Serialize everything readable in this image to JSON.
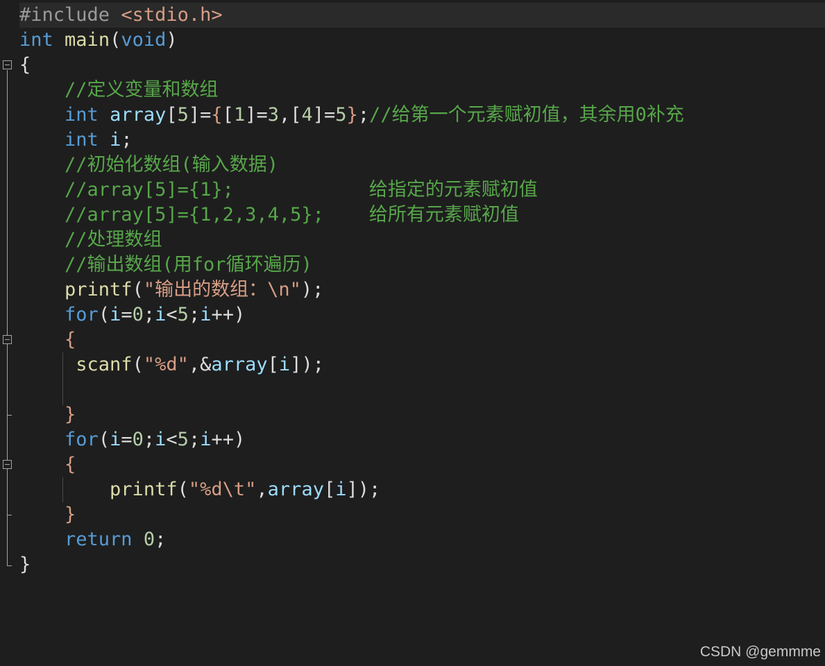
{
  "colors": {
    "background": "#1e1e1e",
    "current_line": "#2a2a2a",
    "text": "#dcdcdc",
    "preprocessor": "#9b9b9b",
    "include_path": "#d69d85",
    "keyword": "#569cd6",
    "function": "#dcdcaa",
    "variable": "#9cdcfe",
    "number": "#b5cea8",
    "string": "#d69d85",
    "comment": "#57a64a",
    "brace": "#d69d85"
  },
  "code_lines": [
    {
      "tokens": [
        {
          "t": "#include",
          "c": "preprocessor"
        },
        {
          "t": " ",
          "c": "text"
        },
        {
          "t": "<stdio.h>",
          "c": "include_path"
        }
      ]
    },
    {
      "tokens": [
        {
          "t": "int",
          "c": "keyword"
        },
        {
          "t": " ",
          "c": "text"
        },
        {
          "t": "main",
          "c": "function"
        },
        {
          "t": "(",
          "c": "text"
        },
        {
          "t": "void",
          "c": "keyword"
        },
        {
          "t": ")",
          "c": "text"
        }
      ]
    },
    {
      "tokens": [
        {
          "t": "{",
          "c": "text"
        }
      ]
    },
    {
      "tokens": [
        {
          "t": "    ",
          "c": "text"
        },
        {
          "t": "//定义变量和数组",
          "c": "comment"
        }
      ]
    },
    {
      "tokens": [
        {
          "t": "    ",
          "c": "text"
        },
        {
          "t": "int",
          "c": "keyword"
        },
        {
          "t": " ",
          "c": "text"
        },
        {
          "t": "array",
          "c": "variable"
        },
        {
          "t": "[",
          "c": "text"
        },
        {
          "t": "5",
          "c": "number"
        },
        {
          "t": "]=",
          "c": "text"
        },
        {
          "t": "{",
          "c": "brace"
        },
        {
          "t": "[",
          "c": "text"
        },
        {
          "t": "1",
          "c": "number"
        },
        {
          "t": "]=",
          "c": "text"
        },
        {
          "t": "3",
          "c": "number"
        },
        {
          "t": ",[",
          "c": "text"
        },
        {
          "t": "4",
          "c": "number"
        },
        {
          "t": "]=",
          "c": "text"
        },
        {
          "t": "5",
          "c": "number"
        },
        {
          "t": "}",
          "c": "brace"
        },
        {
          "t": ";",
          "c": "text"
        },
        {
          "t": "//给第一个元素赋初值，其余用0补充",
          "c": "comment"
        }
      ]
    },
    {
      "tokens": [
        {
          "t": "    ",
          "c": "text"
        },
        {
          "t": "int",
          "c": "keyword"
        },
        {
          "t": " ",
          "c": "text"
        },
        {
          "t": "i",
          "c": "variable"
        },
        {
          "t": ";",
          "c": "text"
        }
      ]
    },
    {
      "tokens": [
        {
          "t": "    ",
          "c": "text"
        },
        {
          "t": "//初始化数组(输入数据)",
          "c": "comment"
        }
      ]
    },
    {
      "tokens": [
        {
          "t": "    ",
          "c": "text"
        },
        {
          "t": "//array[5]={1};            给指定的元素赋初值",
          "c": "comment"
        }
      ]
    },
    {
      "tokens": [
        {
          "t": "    ",
          "c": "text"
        },
        {
          "t": "//array[5]={1,2,3,4,5};    给所有元素赋初值",
          "c": "comment"
        }
      ]
    },
    {
      "tokens": [
        {
          "t": "    ",
          "c": "text"
        },
        {
          "t": "//处理数组",
          "c": "comment"
        }
      ]
    },
    {
      "tokens": [
        {
          "t": "    ",
          "c": "text"
        },
        {
          "t": "//输出数组(用for循环遍历)",
          "c": "comment"
        }
      ]
    },
    {
      "tokens": [
        {
          "t": "    ",
          "c": "text"
        },
        {
          "t": "printf",
          "c": "function"
        },
        {
          "t": "(",
          "c": "text"
        },
        {
          "t": "\"输出的数组：\\n\"",
          "c": "string"
        },
        {
          "t": ");",
          "c": "text"
        }
      ]
    },
    {
      "tokens": [
        {
          "t": "    ",
          "c": "text"
        },
        {
          "t": "for",
          "c": "keyword"
        },
        {
          "t": "(",
          "c": "text"
        },
        {
          "t": "i",
          "c": "variable"
        },
        {
          "t": "=",
          "c": "text"
        },
        {
          "t": "0",
          "c": "number"
        },
        {
          "t": ";",
          "c": "text"
        },
        {
          "t": "i",
          "c": "variable"
        },
        {
          "t": "<",
          "c": "text"
        },
        {
          "t": "5",
          "c": "number"
        },
        {
          "t": ";",
          "c": "text"
        },
        {
          "t": "i",
          "c": "variable"
        },
        {
          "t": "++)",
          "c": "text"
        }
      ]
    },
    {
      "tokens": [
        {
          "t": "    ",
          "c": "text"
        },
        {
          "t": "{",
          "c": "brace"
        }
      ]
    },
    {
      "tokens": [
        {
          "t": "     ",
          "c": "text"
        },
        {
          "t": "scanf",
          "c": "function"
        },
        {
          "t": "(",
          "c": "text"
        },
        {
          "t": "\"%d\"",
          "c": "string"
        },
        {
          "t": ",&",
          "c": "text"
        },
        {
          "t": "array",
          "c": "variable"
        },
        {
          "t": "[",
          "c": "text"
        },
        {
          "t": "i",
          "c": "variable"
        },
        {
          "t": "]);",
          "c": "text"
        }
      ]
    },
    {
      "tokens": []
    },
    {
      "tokens": [
        {
          "t": "    ",
          "c": "text"
        },
        {
          "t": "}",
          "c": "brace"
        }
      ]
    },
    {
      "tokens": [
        {
          "t": "    ",
          "c": "text"
        },
        {
          "t": "for",
          "c": "keyword"
        },
        {
          "t": "(",
          "c": "text"
        },
        {
          "t": "i",
          "c": "variable"
        },
        {
          "t": "=",
          "c": "text"
        },
        {
          "t": "0",
          "c": "number"
        },
        {
          "t": ";",
          "c": "text"
        },
        {
          "t": "i",
          "c": "variable"
        },
        {
          "t": "<",
          "c": "text"
        },
        {
          "t": "5",
          "c": "number"
        },
        {
          "t": ";",
          "c": "text"
        },
        {
          "t": "i",
          "c": "variable"
        },
        {
          "t": "++)",
          "c": "text"
        }
      ]
    },
    {
      "tokens": [
        {
          "t": "    ",
          "c": "text"
        },
        {
          "t": "{",
          "c": "brace"
        }
      ]
    },
    {
      "tokens": [
        {
          "t": "        ",
          "c": "text"
        },
        {
          "t": "printf",
          "c": "function"
        },
        {
          "t": "(",
          "c": "text"
        },
        {
          "t": "\"%d\\t\"",
          "c": "string"
        },
        {
          "t": ",",
          "c": "text"
        },
        {
          "t": "array",
          "c": "variable"
        },
        {
          "t": "[",
          "c": "text"
        },
        {
          "t": "i",
          "c": "variable"
        },
        {
          "t": "]);",
          "c": "text"
        }
      ]
    },
    {
      "tokens": [
        {
          "t": "    ",
          "c": "text"
        },
        {
          "t": "}",
          "c": "brace"
        }
      ]
    },
    {
      "tokens": [
        {
          "t": "    ",
          "c": "text"
        },
        {
          "t": "return",
          "c": "keyword"
        },
        {
          "t": " ",
          "c": "text"
        },
        {
          "t": "0",
          "c": "number"
        },
        {
          "t": ";",
          "c": "text"
        }
      ]
    },
    {
      "tokens": [
        {
          "t": "}",
          "c": "text"
        }
      ]
    }
  ],
  "watermark": "CSDN @gemmme"
}
